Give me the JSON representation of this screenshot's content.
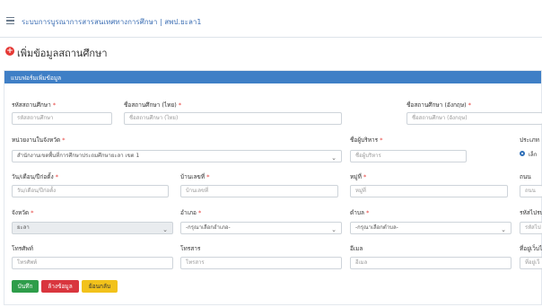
{
  "header": {
    "title": "ระบบการบูรณาการสารสนเทศทางการศึกษา | สพป.ยะลา1"
  },
  "page": {
    "title": "เพิ่มข้อมูลสถานศึกษา"
  },
  "form": {
    "panel_title": "แบบฟอร์มเพิ่มข้อมูล",
    "school_code": {
      "label": "รหัสสถานศึกษา",
      "placeholder": "รหัสสถานศึกษา"
    },
    "name_th": {
      "label": "ชื่อสถานศึกษา (ไทย)",
      "placeholder": "ชื่อสถานศึกษา (ไทย)"
    },
    "name_en": {
      "label": "ชื่อสถานศึกษา (อังกฤษ)",
      "placeholder": "ชื่อสถานศึกษา (อังกฤษ)"
    },
    "agency": {
      "label": "หน่วยงานในจังหวัด",
      "value": "สำนักงานเขตพื้นที่การศึกษาประถมศึกษายะลา เขต 1"
    },
    "director": {
      "label": "ชื่อผู้บริหาร",
      "placeholder": "ชื่อผู้บริหาร"
    },
    "school_type": {
      "label": "ประเภท",
      "option": "เล็ก"
    },
    "founded": {
      "label": "วัน/เดือน/ปีก่อตั้ง",
      "placeholder": "วัน/เดือน/ปีก่อตั้ง"
    },
    "house_no": {
      "label": "บ้านเลขที่",
      "placeholder": "บ้านเลขที่"
    },
    "village_no": {
      "label": "หมู่ที่",
      "placeholder": "หมู่ที่"
    },
    "road": {
      "label": "ถนน",
      "placeholder": "ถนน"
    },
    "province": {
      "label": "จังหวัด",
      "value": "ยะลา"
    },
    "district": {
      "label": "อำเภอ",
      "value": "-กรุณาเลือกอำเภอ-"
    },
    "subdistrict": {
      "label": "ตำบล",
      "value": "-กรุณาเลือกตำบล-"
    },
    "postcode": {
      "label": "รหัสไปรษ",
      "placeholder": "รหัสไป"
    },
    "phone": {
      "label": "โทรศัพท์",
      "placeholder": "โทรศัพท์"
    },
    "fax": {
      "label": "โทรสาร",
      "placeholder": "โทรสาร"
    },
    "email": {
      "label": "อีเมล",
      "placeholder": "อีเมล"
    },
    "website": {
      "label": "ที่อยู่เว็บไซ",
      "placeholder": "ที่อยู่เว็"
    },
    "required_mark": "*"
  },
  "buttons": {
    "save": "บันทึก",
    "clear": "ล้างข้อมูล",
    "back": "ย้อนกลับ"
  },
  "icons": {
    "menu": "hamburger-icon",
    "add": "plus-circle-icon",
    "dropdown": "chevron-down-icon"
  },
  "colors": {
    "header_blue": "#3f7fc6",
    "title_blue": "#3d6fb4",
    "required_red": "#e53935",
    "save_green": "#2e9d4a",
    "clear_red": "#d9363e",
    "back_yellow": "#f2c21b"
  }
}
